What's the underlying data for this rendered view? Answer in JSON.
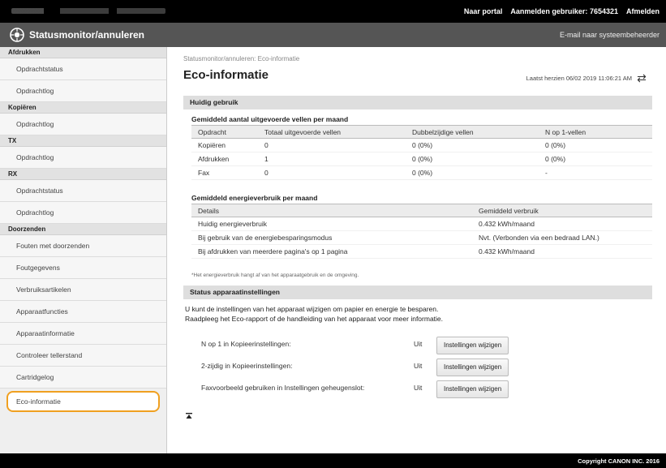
{
  "topbar": {
    "portal": "Naar portal",
    "user_label": "Aanmelden gebruiker:",
    "user_id": "7654321",
    "logout": "Afmelden"
  },
  "header": {
    "title": "Statusmonitor/annuleren",
    "mail_admin": "E-mail naar systeembeheerder",
    "logo_icon": "canon-remote-ui-icon"
  },
  "sidebar": {
    "sections": [
      {
        "head": "Afdrukken",
        "items": [
          "Opdrachtstatus",
          "Opdrachtlog"
        ]
      },
      {
        "head": "Kopiëren",
        "items": [
          "Opdrachtlog"
        ]
      },
      {
        "head": "TX",
        "items": [
          "Opdrachtlog"
        ]
      },
      {
        "head": "RX",
        "items": [
          "Opdrachtstatus",
          "Opdrachtlog"
        ]
      },
      {
        "head": "Doorzenden",
        "items": [
          "Fouten met doorzenden"
        ]
      }
    ],
    "extra": [
      "Foutgegevens",
      "Verbruiksartikelen",
      "Apparaatfuncties",
      "Apparaatinformatie",
      "Controleer tellerstand",
      "Cartridgelog"
    ],
    "active": "Eco-informatie",
    "accent": "#f0a020"
  },
  "main": {
    "breadcrumb": "Statusmonitor/annuleren: Eco-informatie",
    "title": "Eco-informatie",
    "updated": "Laatst herzien 06/02 2019 11:06:21 AM",
    "refresh_icon": "refresh-icon",
    "current_usage": "Huidig gebruik",
    "sheets_head": "Gemiddeld aantal uitgevoerde vellen per maand",
    "sheets_cols": [
      "Opdracht",
      "Totaal uitgevoerde vellen",
      "Dubbelzijdige vellen",
      "N op 1-vellen"
    ],
    "sheets_rows": [
      [
        "Kopiëren",
        "0",
        "0 (0%)",
        "0 (0%)"
      ],
      [
        "Afdrukken",
        "1",
        "0 (0%)",
        "0 (0%)"
      ],
      [
        "Fax",
        "0",
        "0 (0%)",
        "-"
      ]
    ],
    "energy_head": "Gemiddeld energieverbruik per maand",
    "energy_cols": [
      "Details",
      "Gemiddeld verbruik"
    ],
    "energy_rows": [
      [
        "Huidig energieverbruik",
        "0.432 kWh/maand"
      ],
      [
        "Bij gebruik van de energiebesparingsmodus",
        "Nvt. (Verbonden via een bedraad LAN.)"
      ],
      [
        "Bij afdrukken van meerdere pagina's op 1 pagina",
        "0.432 kWh/maand"
      ]
    ],
    "note": "*Het energieverbruik hangt af van het apparaatgebruik en de omgeving.",
    "settings_head": "Status apparaatinstellingen",
    "desc_line1": "U kunt de instellingen van het apparaat wijzigen om papier en energie te besparen.",
    "desc_line2": "Raadpleeg het Eco-rapport of de handleiding van het apparaat voor meer informatie.",
    "settings": [
      {
        "label": "N op 1 in Kopieerinstellingen:",
        "value": "Uit",
        "button": "Instellingen wijzigen"
      },
      {
        "label": "2-zijdig in Kopieerinstellingen:",
        "value": "Uit",
        "button": "Instellingen wijzigen"
      },
      {
        "label": "Faxvoorbeeld gebruiken in Instellingen geheugenslot:",
        "value": "Uit",
        "button": "Instellingen wijzigen"
      }
    ],
    "totop_icon": "back-to-top-icon"
  },
  "footer": {
    "copyright": "Copyright CANON INC. 2016"
  }
}
